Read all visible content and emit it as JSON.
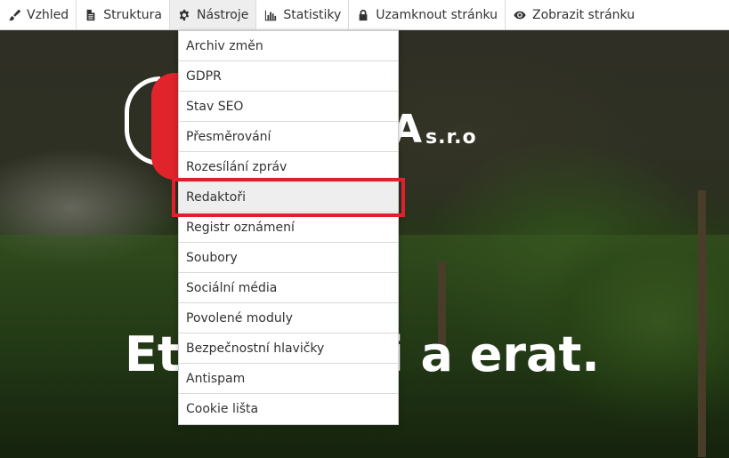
{
  "toolbar": {
    "items": [
      {
        "label": "Vzhled",
        "icon": "brush-icon"
      },
      {
        "label": "Struktura",
        "icon": "document-icon"
      },
      {
        "label": "Nástroje",
        "icon": "gear-icon"
      },
      {
        "label": "Statistiky",
        "icon": "bar-chart-icon"
      },
      {
        "label": "Uzamknout stránku",
        "icon": "lock-icon"
      },
      {
        "label": "Zobrazit stránku",
        "icon": "eye-icon"
      }
    ]
  },
  "dropdown": {
    "items": [
      "Archiv změn",
      "GDPR",
      "Stav SEO",
      "Přesměrování",
      "Rozesílání zpráv",
      "Redaktoři",
      "Registr oznámení",
      "Soubory",
      "Sociální média",
      "Povolené moduly",
      "Bezpečnostní hlavičky",
      "Antispam",
      "Cookie lišta"
    ],
    "highlighted": "Redaktoři"
  },
  "hero": {
    "logo_suffix": "A",
    "logo_sro": "s.r.o",
    "headline": "Et tas wisi a erat."
  },
  "colors": {
    "highlight_border": "#e0202b",
    "logo_red": "#e1242b"
  }
}
